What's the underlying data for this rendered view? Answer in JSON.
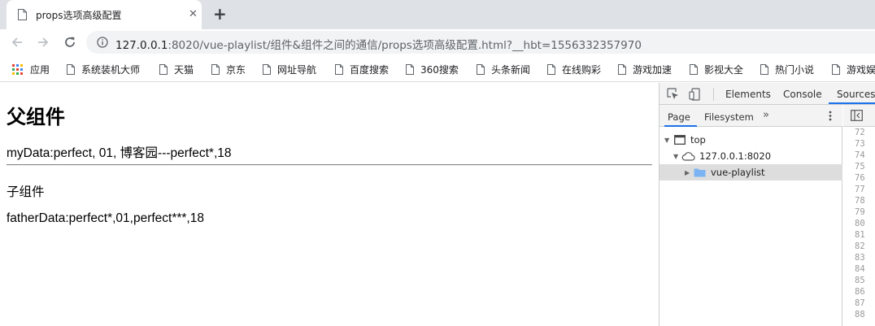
{
  "browser": {
    "tab": {
      "title": "props选项高级配置",
      "close_glyph": "✕"
    },
    "new_tab_glyph": "+",
    "address": {
      "host": "127.0.0.1",
      "path": ":8020/vue-playlist/组件&组件之间的通信/props选项高级配置.html?__hbt=1556332357970"
    },
    "bookmarks": [
      {
        "label": "应用",
        "icon": "apps-grid-icon"
      },
      {
        "label": "系统装机大师",
        "icon": "page-icon"
      },
      {
        "label": "天猫",
        "icon": "page-icon"
      },
      {
        "label": "京东",
        "icon": "page-icon"
      },
      {
        "label": "网址导航",
        "icon": "page-icon"
      },
      {
        "label": "百度搜索",
        "icon": "page-icon"
      },
      {
        "label": "360搜索",
        "icon": "page-icon"
      },
      {
        "label": "头条新闻",
        "icon": "page-icon"
      },
      {
        "label": "在线购彩",
        "icon": "page-icon"
      },
      {
        "label": "游戏加速",
        "icon": "page-icon"
      },
      {
        "label": "影视大全",
        "icon": "page-icon"
      },
      {
        "label": "热门小说",
        "icon": "page-icon"
      },
      {
        "label": "游戏娱",
        "icon": "page-icon"
      }
    ]
  },
  "page": {
    "heading": "父组件",
    "my_data": "myData:perfect, 01, 博客园---perfect*,18",
    "child_label": "子组件",
    "father_data": "fatherData:perfect*,01,perfect***,18"
  },
  "devtools": {
    "tabs": [
      "Elements",
      "Console",
      "Sources"
    ],
    "active_tab": "Sources",
    "navigator_tabs": [
      "Page",
      "Filesystem"
    ],
    "more_glyph": "»",
    "tree": [
      {
        "label": "top",
        "icon": "frame-icon",
        "expanded": true
      },
      {
        "label": "127.0.0.1:8020",
        "icon": "cloud-icon",
        "expanded": true
      },
      {
        "label": "vue-playlist",
        "icon": "folder-icon",
        "expanded": false,
        "selected": true
      }
    ],
    "line_numbers": [
      "72",
      "73",
      "74",
      "75",
      "76",
      "77",
      "78",
      "79",
      "80",
      "81",
      "82",
      "83",
      "84",
      "85",
      "86",
      "87",
      "88"
    ]
  },
  "colors": {
    "tabstrip": "#dee1e6",
    "omnibox": "#f1f3f4",
    "devtools_accent": "#1a73e8",
    "folder": "#7cb3f2"
  }
}
